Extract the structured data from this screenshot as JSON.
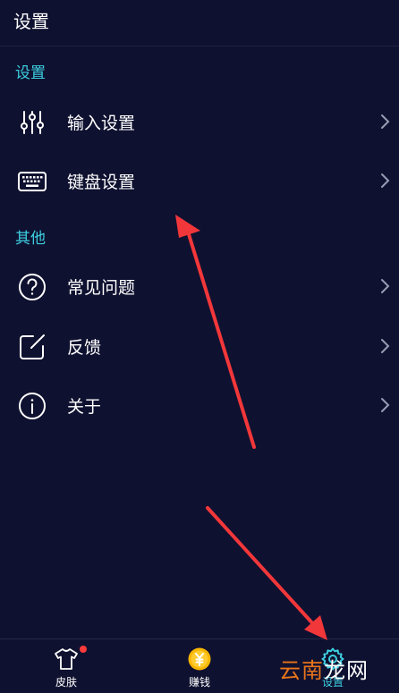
{
  "header": {
    "title": "设置"
  },
  "sections": [
    {
      "title": "设置",
      "items": [
        {
          "label": "输入设置",
          "icon": "sliders-icon"
        },
        {
          "label": "键盘设置",
          "icon": "keyboard-icon"
        }
      ]
    },
    {
      "title": "其他",
      "items": [
        {
          "label": "常见问题",
          "icon": "question-circle-icon"
        },
        {
          "label": "反馈",
          "icon": "edit-square-icon"
        },
        {
          "label": "关于",
          "icon": "info-circle-icon"
        }
      ]
    }
  ],
  "bottom_nav": {
    "tabs": [
      {
        "label": "皮肤",
        "icon": "tshirt-icon",
        "badge": true
      },
      {
        "label": "赚钱",
        "icon": "yen-coin-icon"
      },
      {
        "label": "设置",
        "icon": "gear-icon",
        "active": true
      }
    ]
  },
  "watermark": {
    "part1": "云南",
    "part2": "龙网"
  },
  "colors": {
    "background": "#0f1130",
    "accent": "#3ccfe0",
    "badge": "#ff3b3b",
    "annotation_arrow": "#f2373a"
  }
}
